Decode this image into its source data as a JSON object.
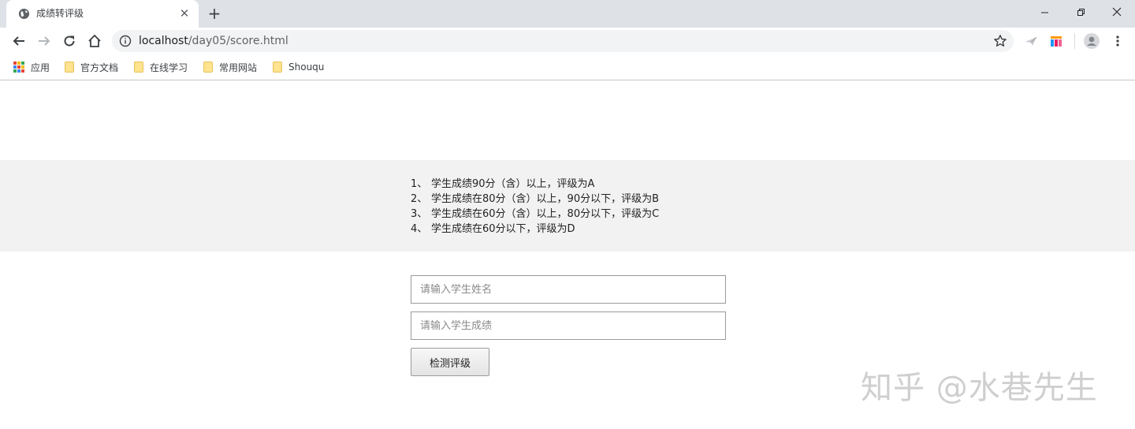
{
  "browser": {
    "tab_title": "成绩转评级",
    "url_host": "localhost",
    "url_path": "/day05/score.html",
    "bookmarks": [
      {
        "label": "应用",
        "icon": "apps-grid-icon"
      },
      {
        "label": "官方文档",
        "icon": "folder-icon"
      },
      {
        "label": "在线学习",
        "icon": "folder-icon"
      },
      {
        "label": "常用网站",
        "icon": "folder-icon"
      },
      {
        "label": "Shouqu",
        "icon": "folder-icon"
      }
    ]
  },
  "rules": [
    {
      "num": "1、",
      "text": "学生成绩90分（含）以上，评级为A"
    },
    {
      "num": "2、",
      "text": "学生成绩在80分（含）以上，90分以下，评级为B"
    },
    {
      "num": "3、",
      "text": "学生成绩在60分（含）以上，80分以下，评级为C"
    },
    {
      "num": "4、",
      "text": "学生成绩在60分以下，评级为D"
    }
  ],
  "form": {
    "name_placeholder": "请输入学生姓名",
    "score_placeholder": "请输入学生成绩",
    "check_button": "检测评级"
  },
  "watermark": "知乎 @水巷先生"
}
